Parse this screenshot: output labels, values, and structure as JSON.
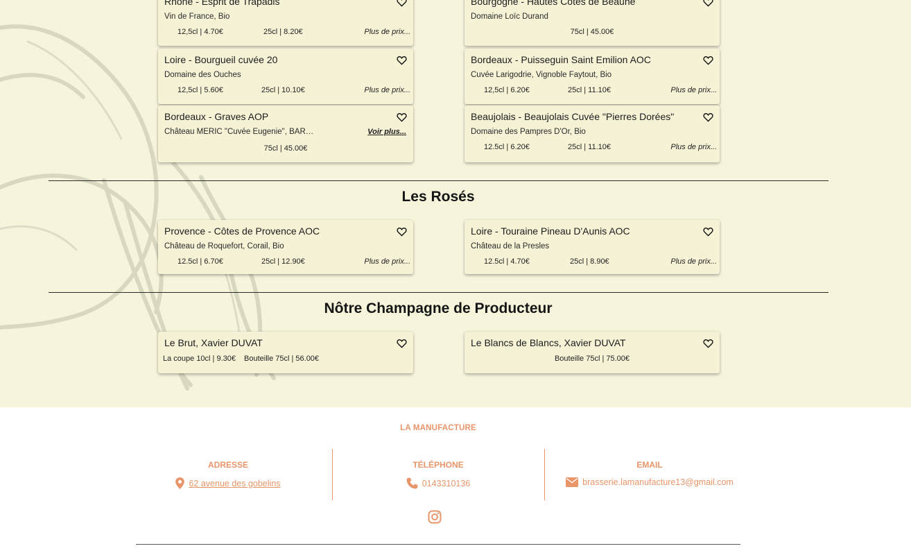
{
  "wines_top": [
    {
      "title": "Rhône - Esprit de Trapadis",
      "subtitle": "Vin de France, Bio",
      "price1": "12,5cl | 4.70€",
      "price2": "25cl | 8.20€",
      "more": "Plus de prix..."
    },
    {
      "title": "Bourgogne - Hautes Côtes de Beaune",
      "subtitle": "Domaine Loïc Durand",
      "price1": "75cl | 45.00€"
    },
    {
      "title": "Loire - Bourgueil cuvée 20",
      "subtitle": "Domaine des Ouches",
      "price1": "12,5cl | 5.60€",
      "price2": "25cl | 10.10€",
      "more": "Plus de prix..."
    },
    {
      "title": "Bordeaux - Puisseguin Saint Emilion AOC",
      "subtitle": "Cuvée Larigodrie, Vignoble Faytout, Bio",
      "price1": "12,5cl | 6.20€",
      "price2": "25cl | 11.10€",
      "more": "Plus de prix..."
    },
    {
      "title": "Bordeaux - Graves AOP",
      "subtitle": "Château MERIC \"Cuvée Eugenie\", BARON,...",
      "voir": "Voir plus...",
      "price1": "75cl | 45.00€"
    },
    {
      "title": "Beaujolais - Beaujolais Cuvée \"Pierres Dorées\"",
      "subtitle": "Domaine des Pampres D'Or, Bio",
      "price1": "12.5cl | 6.20€",
      "price2": "25cl | 11.10€",
      "more": "Plus de prix..."
    }
  ],
  "roses": {
    "title": "Les Rosés",
    "items": [
      {
        "title": "Provence - Côtes de Provence AOC",
        "subtitle": "Château de Roquefort, Corail, Bio",
        "price1": "12.5cl | 6.70€",
        "price2": "25cl | 12.90€",
        "more": "Plus de prix..."
      },
      {
        "title": "Loire - Touraine Pineau D'Aunis AOC",
        "subtitle": "Château de la Presles",
        "price1": "12.5cl | 4.70€",
        "price2": "25cl | 8.90€",
        "more": "Plus de prix..."
      }
    ]
  },
  "champagne": {
    "title": "Nôtre Champagne de Producteur",
    "items": [
      {
        "title": "Le Brut, Xavier DUVAT",
        "price1": "La coupe 10cl | 9.30€",
        "price2": "Bouteille 75cl | 56.00€"
      },
      {
        "title": "Le Blancs de Blancs, Xavier DUVAT",
        "price1": "Bouteille 75cl | 75.00€"
      }
    ]
  },
  "footer": {
    "brand": "LA MANUFACTURE",
    "address_label": "ADRESSE",
    "address": "62 avenue des gobelins",
    "phone_label": "TÉLÉPHONE",
    "phone": "0143310136",
    "email_label": "EMAIL",
    "email": "brasserie.lamanufacture13@gmail.com"
  },
  "icons": {
    "favorite": "heart-outline-icon",
    "address": "map-pin-icon",
    "phone": "phone-icon",
    "email": "envelope-icon",
    "social": "instagram-icon"
  },
  "colors": {
    "menu_background": "#f7f4dc",
    "card_background": "#f5f2d6",
    "footer_accent": "#e8956a",
    "text": "#1c1c1c"
  }
}
